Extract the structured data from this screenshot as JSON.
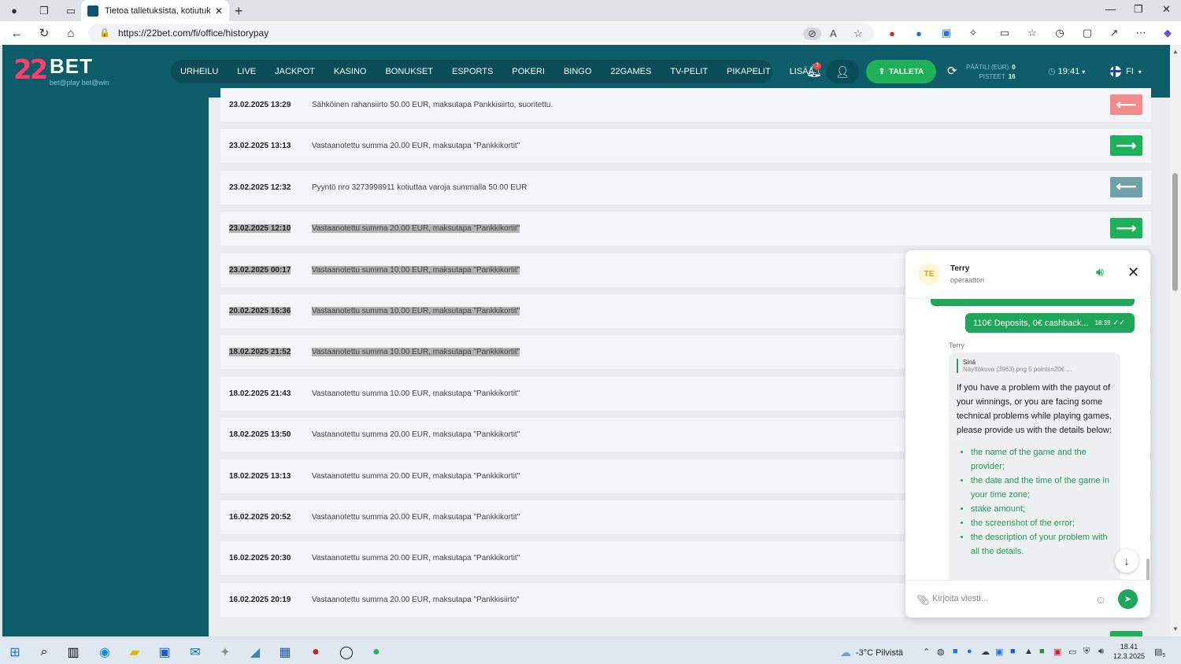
{
  "browser": {
    "tab_title": "Tietoa talletuksista, kotiutuksista ja",
    "url": "https://22bet.com/fi/office/historypay"
  },
  "site": {
    "logo_mark": "22",
    "logo_text": "BET",
    "logo_sub": "bet@play  bet@win",
    "nav": [
      "URHEILU",
      "LIVE",
      "JACKPOT",
      "KASINO",
      "BONUKSET",
      "ESPORTS",
      "POKERI",
      "BINGO",
      "22GAMES",
      "TV-PELIT",
      "PIKAPELIT",
      "LISÄÄ"
    ],
    "bell_count": "3",
    "deposit_label": "TALLETA",
    "balance_label": "PÄÄTILI (EUR)",
    "balance_value": "0",
    "points_label": "PISTEET",
    "points_value": "16",
    "time": "19:41",
    "lang": "FI"
  },
  "history": [
    {
      "date": "23.02.2025 13:29",
      "desc": "Sähköinen rahansiirto 50.00 EUR, maksutapa Pankkisiirto, suoritettu.",
      "arrow": "out-pink"
    },
    {
      "date": "23.02.2025 13:13",
      "desc": "Vastaanotettu summa 20.00 EUR, maksutapa \"Pankkikortit\"",
      "arrow": "in"
    },
    {
      "date": "23.02.2025 12:32",
      "desc": "Pyyntö nro 3273998911 kotiuttaa varoja summalla 50.00 EUR",
      "arrow": "out-gray"
    },
    {
      "date": "23.02.2025 12:10",
      "desc": "Vastaanotettu summa 20.00 EUR, maksutapa \"Pankkikortit\"",
      "arrow": "in",
      "selected": true
    },
    {
      "date": "23.02.2025 00:17",
      "desc": "Vastaanotettu summa 10.00 EUR, maksutapa \"Pankkikortit\"",
      "selected": true
    },
    {
      "date": "20.02.2025 16:36",
      "desc": "Vastaanotettu summa 10.00 EUR, maksutapa \"Pankkikortit\"",
      "selected": true
    },
    {
      "date": "18.02.2025 21:52",
      "desc": "Vastaanotettu summa 10.00 EUR, maksutapa \"Pankkikortit\"",
      "selected": true
    },
    {
      "date": "18.02.2025 21:43",
      "desc": "Vastaanotettu summa 10.00 EUR, maksutapa \"Pankkikortit\""
    },
    {
      "date": "18.02.2025 13:50",
      "desc": "Vastaanotettu summa 20.00 EUR, maksutapa \"Pankkikortit\""
    },
    {
      "date": "18.02.2025 13:13",
      "desc": "Vastaanotettu summa 20.00 EUR, maksutapa \"Pankkikortit\""
    },
    {
      "date": "16.02.2025 20:52",
      "desc": "Vastaanotettu summa 20.00 EUR, maksutapa \"Pankkikortit\""
    },
    {
      "date": "16.02.2025 20:30",
      "desc": "Vastaanotettu summa 20.00 EUR, maksutapa \"Pankkikortit\""
    },
    {
      "date": "16.02.2025 20:19",
      "desc": "Vastaanotettu summa 20.00 EUR, maksutapa \"Pankkisiirto\""
    }
  ],
  "chat": {
    "avatar": "TE",
    "agent_name": "Terry",
    "agent_role": "operaattori",
    "out_message": "110€ Deposits, 0€ cashback...",
    "out_time": "18:39",
    "op_label": "Terry",
    "quote_who": "Sinä",
    "quote_text": "Näyttökuva (3963).png 5 points=20€ ...",
    "message": "If you have a problem with the payout of your winnings, or you are facing some technical problems while playing games, please provide us with the details below:",
    "list": [
      "the name of the game and the provider;",
      "the date and the time of the game in your time zone;",
      "stake amount;",
      "the screenshot of the error;",
      "the description of your problem with all the details."
    ],
    "input_placeholder": "Kirjoita viesti..."
  },
  "taskbar": {
    "weather": "-3°C  Pilvistä",
    "time": "18.41",
    "date": "12.3.2025",
    "notif_count": "5"
  },
  "colors": {
    "brand": "#0d5c6a",
    "accent_green": "#1fb15a",
    "pink": "#f28b8b",
    "gray_arrow": "#6fa1a8"
  }
}
